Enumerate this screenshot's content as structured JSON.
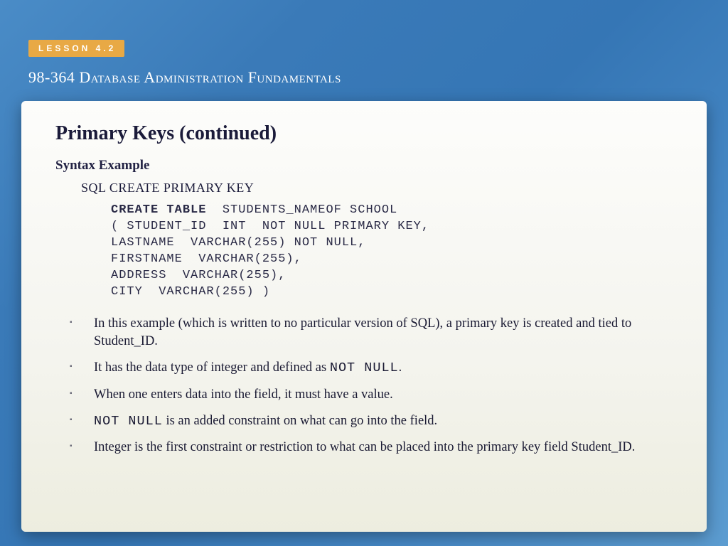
{
  "lesson_tag": "LESSON 4.2",
  "course_title": "98-364 Database Administration Fundamentals",
  "slide": {
    "title": "Primary Keys (continued)",
    "subheading": "Syntax  Example",
    "sql_heading": "SQL CREATE PRIMARY KEY",
    "code": {
      "l1_kw": "CREATE TABLE",
      "l1_rest": "  STUDENTS_NAMEOF SCHOOL",
      "l2": "( STUDENT_ID  INT  NOT NULL PRIMARY KEY,",
      "l3": "LASTNAME  VARCHAR(255) NOT NULL,",
      "l4": "FIRSTNAME  VARCHAR(255),",
      "l5": "ADDRESS  VARCHAR(255),",
      "l6": "CITY  VARCHAR(255) )"
    },
    "bullets": {
      "b1": "In this example (which is written to no particular version of SQL), a primary key is created and tied to Student_ID.",
      "b2_a": "It has the data type of integer and defined as ",
      "b2_code": "NOT NULL",
      "b2_b": ".",
      "b3": "When one enters data into the field, it must have a value.",
      "b4_code": "NOT NULL",
      "b4_rest": " is an added constraint on what can go into the field.",
      "b5": "Integer is the first constraint or restriction to what can be placed into the primary key field Student_ID."
    }
  }
}
